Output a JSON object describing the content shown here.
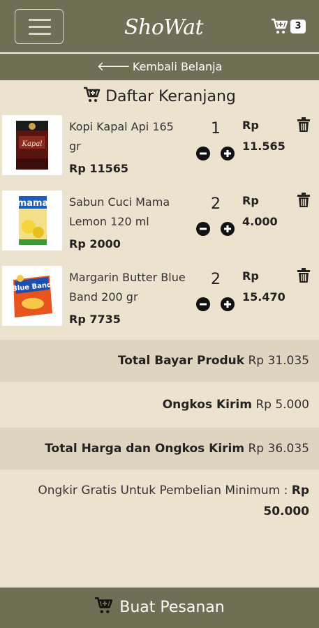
{
  "header": {
    "logo_text": "ShoWat",
    "menu_icon": "hamburger-menu-icon",
    "cart_icon": "cart-plus-icon",
    "cart_count": "3"
  },
  "back_link": {
    "label": "Kembali Belanja",
    "icon": "arrow-left-icon"
  },
  "page_title": "Daftar Keranjang",
  "items": [
    {
      "name": "Kopi Kapal Api 165 gr",
      "price": "Rp 11565",
      "qty": "1",
      "subtotal_currency": "Rp",
      "subtotal_value": "11.565"
    },
    {
      "name": "Sabun Cuci Mama Lemon 120 ml",
      "price": "Rp 2000",
      "qty": "2",
      "subtotal_currency": "Rp",
      "subtotal_value": "4.000"
    },
    {
      "name": "Margarin Butter Blue Band 200 gr",
      "price": "Rp 7735",
      "qty": "2",
      "subtotal_currency": "Rp",
      "subtotal_value": "15.470"
    }
  ],
  "totals": {
    "product_label": "Total Bayar Produk",
    "product_value": "Rp 31.035",
    "shipping_label": "Ongkos Kirim",
    "shipping_value": "Rp 5.000",
    "grand_label": "Total Harga dan Ongkos Kirim",
    "grand_value": "Rp 36.035"
  },
  "note": {
    "text": "Ongkir Gratis Untuk Pembelian Minimum :",
    "amount_line1": "Rp",
    "amount_line2": "50.000"
  },
  "order_button": {
    "label": "Buat Pesanan"
  },
  "colors": {
    "bar": "#6F6F56",
    "background": "#ECE3CF",
    "shaded_row": "#DED5C1"
  }
}
